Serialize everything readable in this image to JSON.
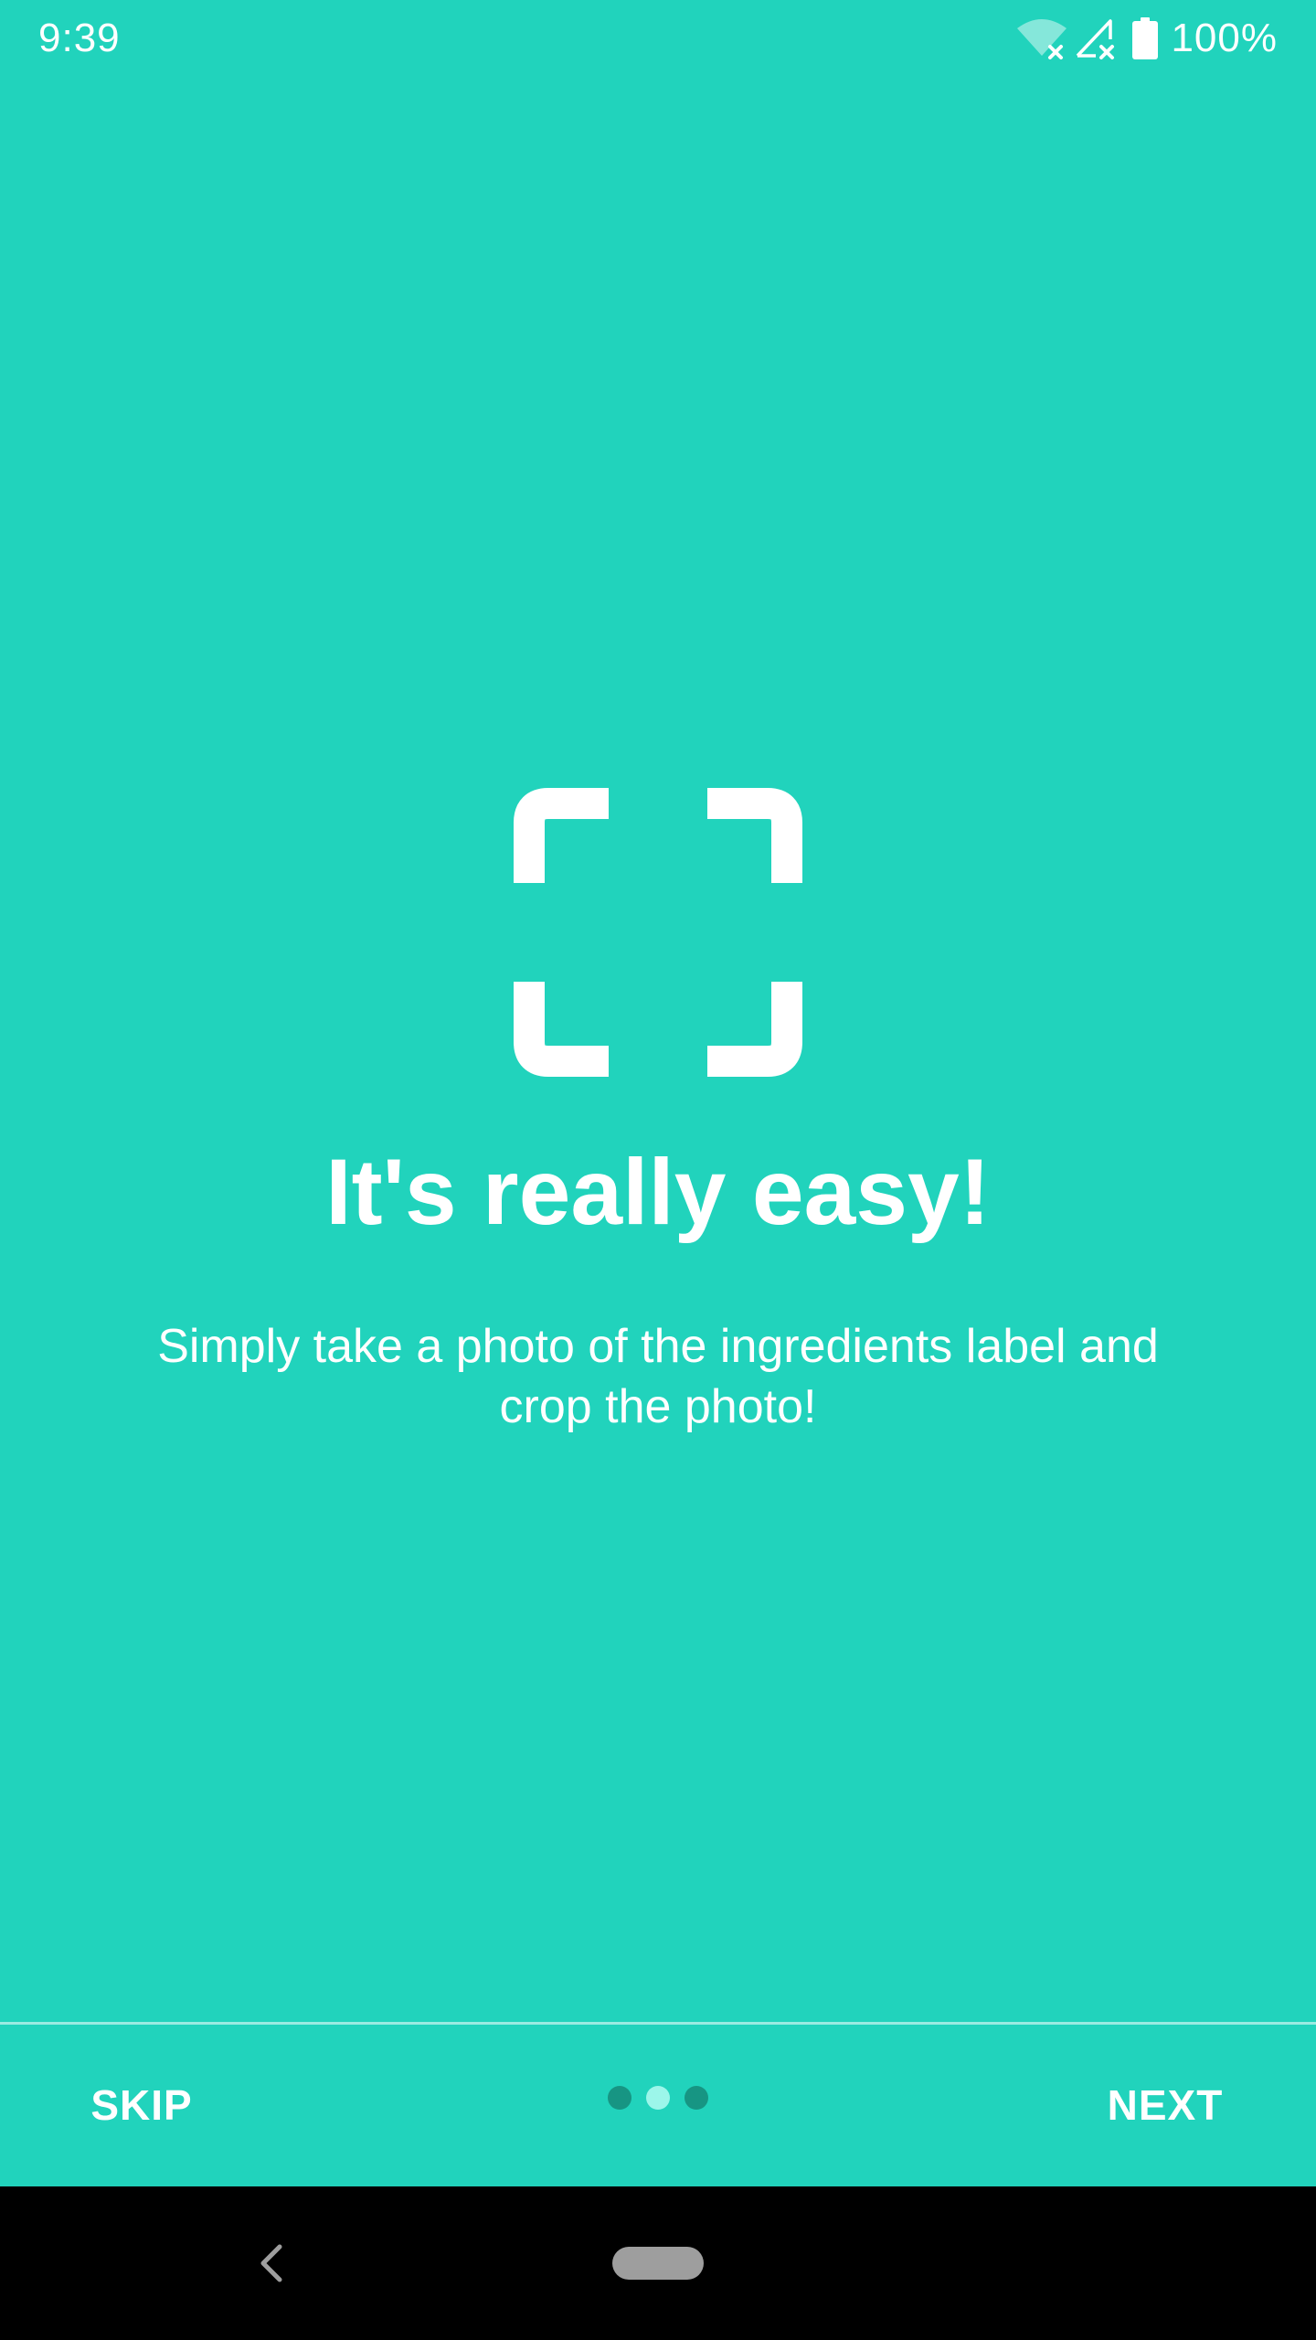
{
  "status_bar": {
    "time": "9:39",
    "battery": "100%",
    "icons": [
      "wifi-off-icon",
      "signal-off-icon",
      "battery-full-icon"
    ]
  },
  "onboarding": {
    "icon": "scan-frame-icon",
    "title": "It's really easy!",
    "subtitle": "Simply take a photo of the ingredients label and crop the photo!",
    "page_count": 3,
    "current_page": 2
  },
  "controls": {
    "skip_label": "SKIP",
    "next_label": "NEXT"
  },
  "navigation_bar": {
    "icons": [
      "back-icon",
      "home-pill-icon"
    ]
  },
  "colors": {
    "background": "#21d3bc",
    "text": "#ffffff",
    "dot_inactive": "#179583",
    "dot_active": "#9cf6ea",
    "nav_bar": "#000000"
  }
}
